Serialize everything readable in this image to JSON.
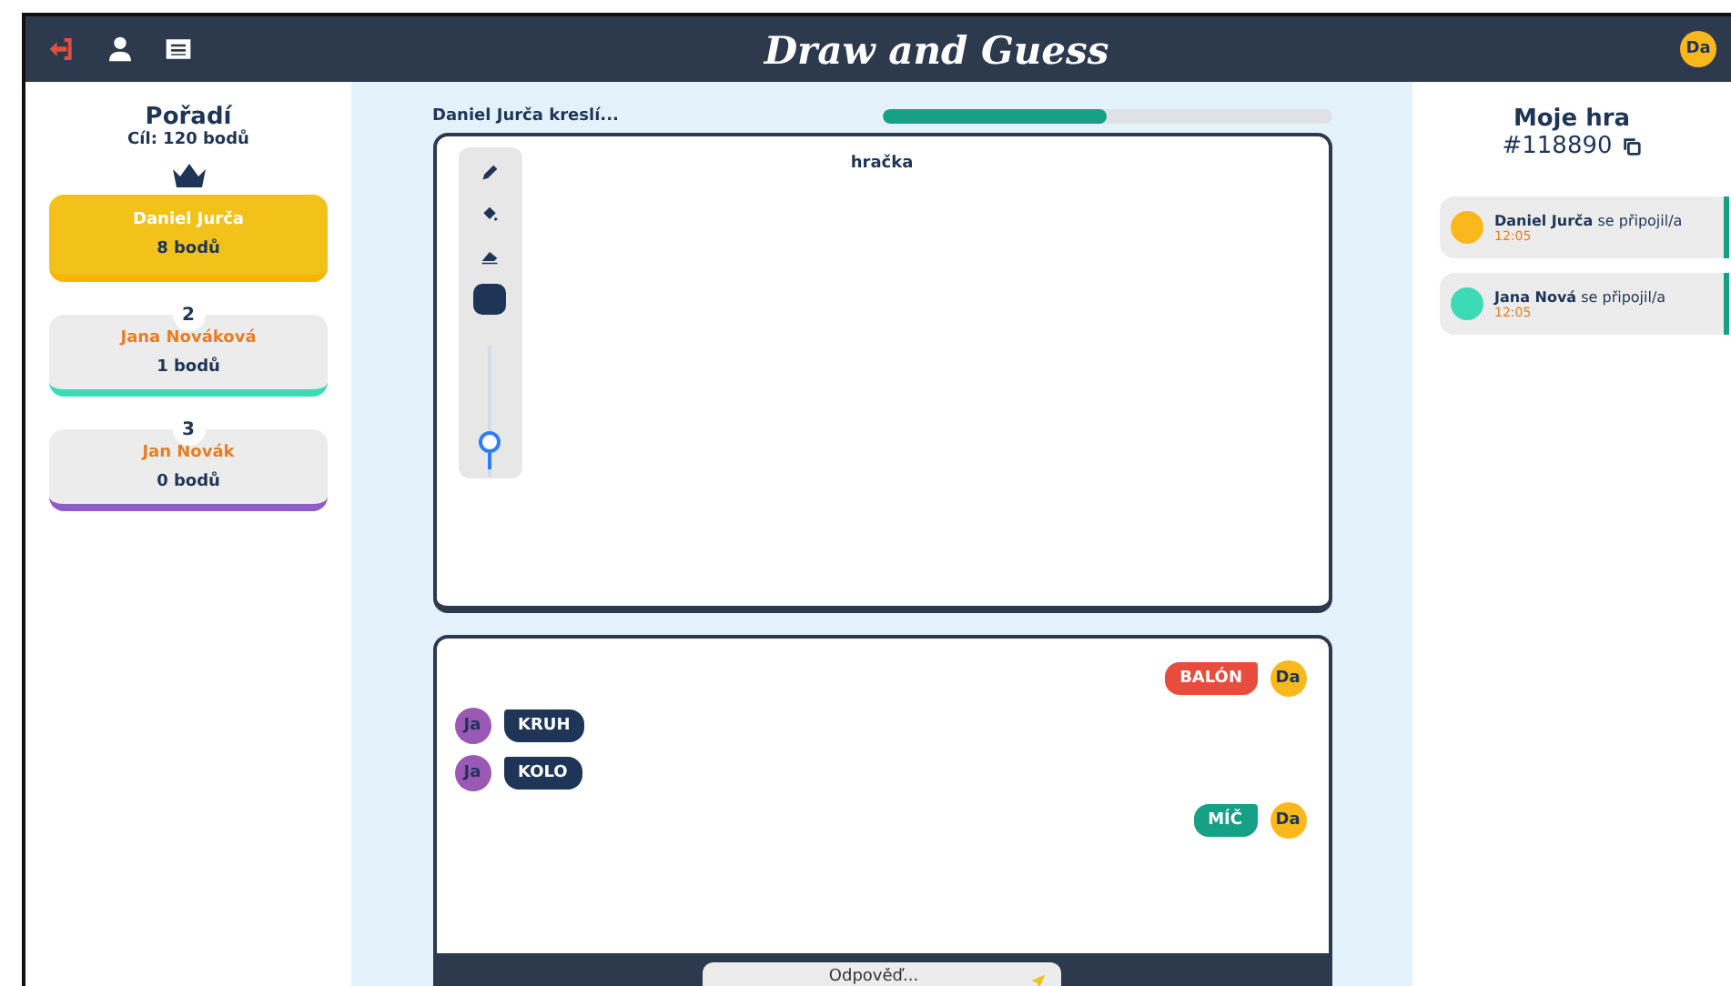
{
  "header": {
    "title": "Draw and Guess",
    "avatar": "Da"
  },
  "ranking": {
    "title": "Pořadí",
    "goal": "Cíl: 120 bodů",
    "players": [
      {
        "name": "Daniel Jurča",
        "points": "8 bodů",
        "leader": true,
        "color": "#f2c21a"
      },
      {
        "rank": "2",
        "name": "Jana Nováková",
        "points": "1 bodů",
        "leader": false,
        "color": "#3ddbb5"
      },
      {
        "rank": "3",
        "name": "Jan Novák",
        "points": "0 bodů",
        "leader": false,
        "color": "#8e5cc6"
      }
    ]
  },
  "round": {
    "drawer": "Daniel Jurča kreslí...",
    "timer": {
      "level": 0.5
    }
  },
  "canvas": {
    "word": "hračka",
    "tools": [
      {
        "kind": "pencil"
      },
      {
        "kind": "bucket"
      },
      {
        "kind": "eraser"
      }
    ],
    "brush_size": {
      "level": 0.12
    }
  },
  "chat": {
    "messages": [
      {
        "kind": "mine",
        "avatar": "Da",
        "text": "BALÓN",
        "color": "#e84c3d"
      },
      {
        "kind": "theirs",
        "avatar": "Ja",
        "text": "KRUH",
        "color": "#1e3557"
      },
      {
        "kind": "theirs",
        "avatar": "Ja",
        "text": "KOLO",
        "color": "#1e3557"
      },
      {
        "kind": "mine",
        "avatar": "Da",
        "text": "MÍČ",
        "color": "#16a085"
      }
    ],
    "input": {
      "placeholder": "Odpověď..."
    }
  },
  "game": {
    "title": "Moje hra",
    "code": "#118890",
    "events": [
      {
        "name": "Daniel Jurča",
        "action": "se připojil/a",
        "time": "12:05",
        "color": "#fbb81c"
      },
      {
        "name": "Jana Nová",
        "action": "se připojil/a",
        "time": "12:05",
        "color": "#3ddbb5"
      }
    ]
  }
}
